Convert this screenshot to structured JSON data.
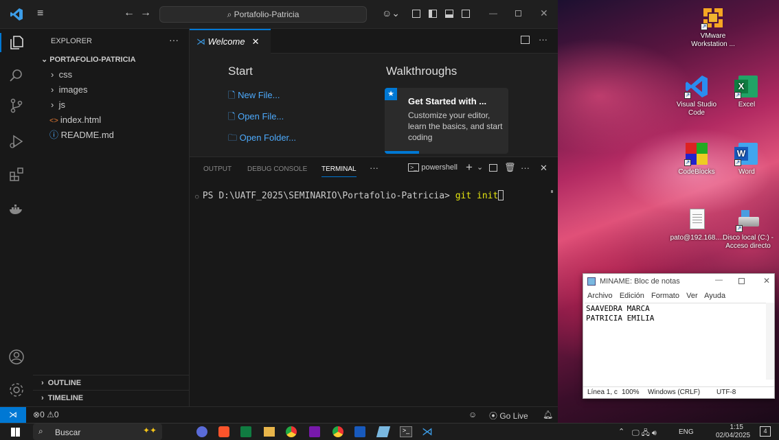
{
  "window": {
    "search_text": "Portafolio-Patricia"
  },
  "sidebar": {
    "header": "EXPLORER",
    "more": "···",
    "project": "PORTAFOLIO-PATRICIA",
    "items": [
      {
        "label": "css",
        "kind": "folder"
      },
      {
        "label": "images",
        "kind": "folder"
      },
      {
        "label": "js",
        "kind": "folder"
      },
      {
        "label": "index.html",
        "kind": "html"
      },
      {
        "label": "README.md",
        "kind": "info"
      }
    ],
    "outline": "OUTLINE",
    "timeline": "TIMELINE"
  },
  "editor": {
    "tab_label": "Welcome",
    "start_heading": "Start",
    "new_file": "New File...",
    "open_file": "Open File...",
    "open_folder": "Open Folder...",
    "walkthroughs_heading": "Walkthroughs",
    "card_title": "Get Started with ...",
    "card_desc": "Customize your editor, learn the basics, and start coding"
  },
  "panel": {
    "tabs": [
      "OUTPUT",
      "DEBUG CONSOLE",
      "TERMINAL"
    ],
    "active_tab": "TERMINAL",
    "shell": "powershell",
    "prompt": "PS D:\\UATF_2025\\SEMINARIO\\Portafolio-Patricia>",
    "command": "git init"
  },
  "status": {
    "errors": "0",
    "warnings": "0",
    "golive": "Go Live"
  },
  "desktop": {
    "icons": [
      {
        "label": "VMware Workstation ..."
      },
      {
        "label": "Visual Studio Code"
      },
      {
        "label": "Excel"
      },
      {
        "label": "CodeBlocks"
      },
      {
        "label": "Word"
      },
      {
        "label": "pato@192.168...."
      },
      {
        "label": "Disco local (C:) - Acceso directo"
      }
    ]
  },
  "notepad": {
    "title": "MINAME: Bloc de notas",
    "menu": [
      "Archivo",
      "Edición",
      "Formato",
      "Ver",
      "Ayuda"
    ],
    "lines": [
      "SAAVEDRA MARCA",
      "PATRICIA EMILIA"
    ],
    "status": {
      "pos": "Línea 1, c",
      "zoom": "100%",
      "eol": "Windows (CRLF)",
      "enc": "UTF-8"
    }
  },
  "taskbar": {
    "search": "Buscar",
    "tray_lang": "ENG",
    "time": "1:15",
    "date": "02/04/2025",
    "notif": "4"
  },
  "colors": {
    "accent": "#0078d4",
    "link": "#4daafc",
    "activity_bg": "#181818",
    "editor_bg": "#1f1f1f"
  }
}
